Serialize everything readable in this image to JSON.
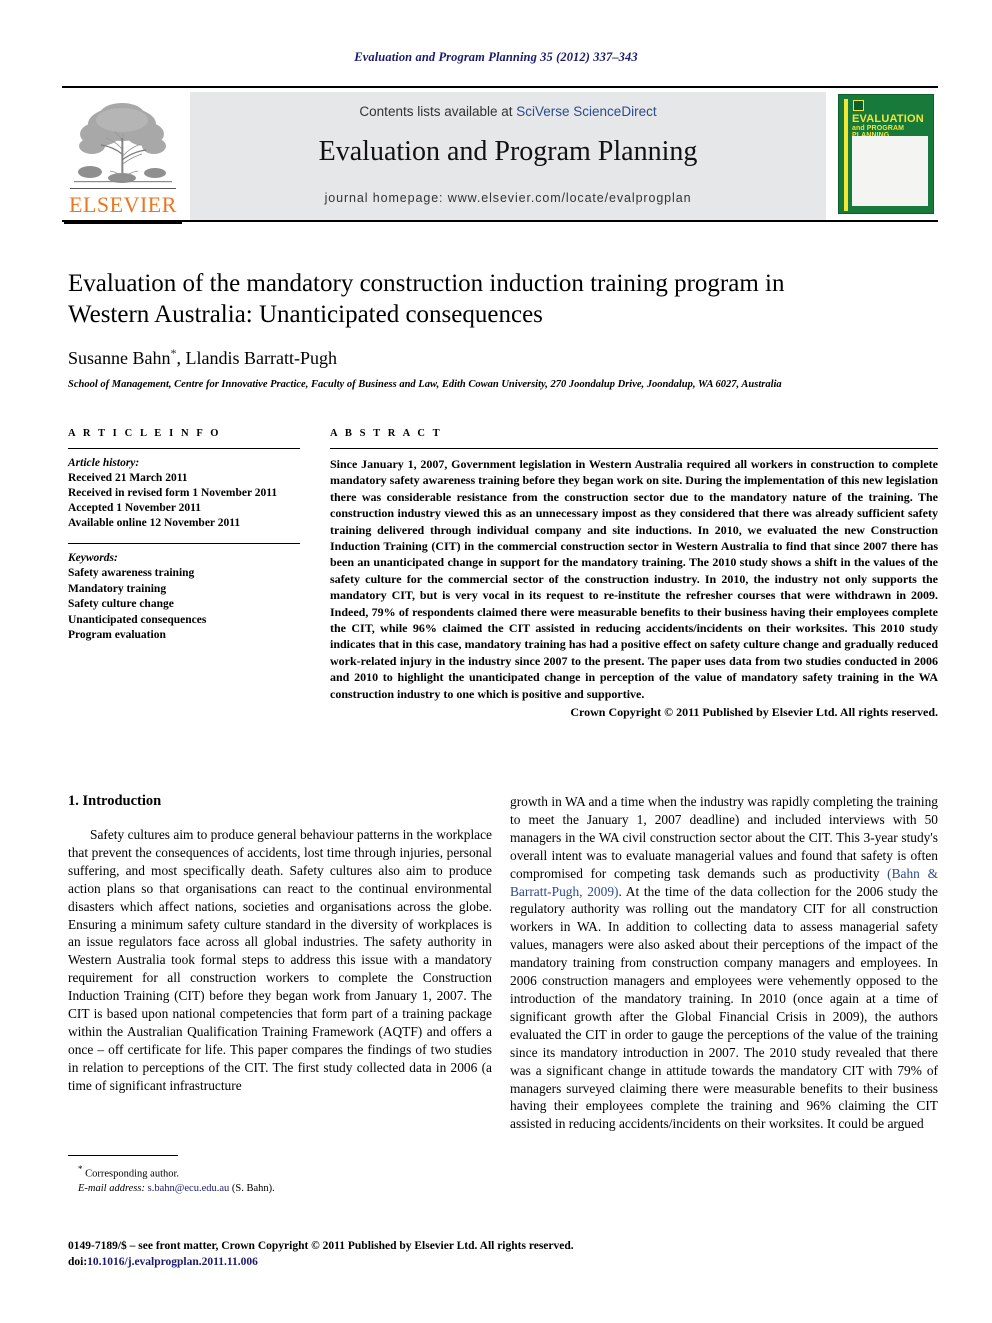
{
  "running_head": "Evaluation and Program Planning 35 (2012) 337–343",
  "masthead": {
    "contents_prefix": "Contents lists available at ",
    "contents_link": "SciVerse ScienceDirect",
    "journal_title": "Evaluation and Program Planning",
    "homepage": "journal homepage: www.elsevier.com/locate/evalprogplan",
    "publisher_name": "ELSEVIER",
    "cover": {
      "title_line1": "EVALUATION",
      "title_line2": "and PROGRAM PLANNING"
    }
  },
  "article": {
    "title": "Evaluation of the mandatory construction induction training program in Western Australia: Unanticipated consequences",
    "authors": "Susanne Bahn",
    "authors_rest": ", Llandis Barratt-Pugh",
    "corresponding_marker": "*",
    "affiliation": "School of Management, Centre for Innovative Practice, Faculty of Business and Law, Edith Cowan University, 270 Joondalup Drive, Joondalup, WA 6027, Australia"
  },
  "article_info": {
    "heading": "A R T I C L E   I N F O",
    "history_label": "Article history:",
    "history": [
      "Received 21 March 2011",
      "Received in revised form 1 November 2011",
      "Accepted 1 November 2011",
      "Available online 12 November 2011"
    ],
    "keywords_label": "Keywords:",
    "keywords": [
      "Safety awareness training",
      "Mandatory training",
      "Safety culture change",
      "Unanticipated consequences",
      "Program evaluation"
    ]
  },
  "abstract": {
    "heading": "A B S T R A C T",
    "text": "Since January 1, 2007, Government legislation in Western Australia required all workers in construction to complete mandatory safety awareness training before they began work on site. During the implementation of this new legislation there was considerable resistance from the construction sector due to the mandatory nature of the training. The construction industry viewed this as an unnecessary impost as they considered that there was already sufficient safety training delivered through individual company and site inductions. In 2010, we evaluated the new Construction Induction Training (CIT) in the commercial construction sector in Western Australia to find that since 2007 there has been an unanticipated change in support for the mandatory training. The 2010 study shows a shift in the values of the safety culture for the commercial sector of the construction industry. In 2010, the industry not only supports the mandatory CIT, but is very vocal in its request to re-institute the refresher courses that were withdrawn in 2009. Indeed, 79% of respondents claimed there were measurable benefits to their business having their employees complete the CIT, while 96% claimed the CIT assisted in reducing accidents/incidents on their worksites. This 2010 study indicates that in this case, mandatory training has had a positive effect on safety culture change and gradually reduced work-related injury in the industry since 2007 to the present. The paper uses data from two studies conducted in 2006 and 2010 to highlight the unanticipated change in perception of the value of mandatory safety training in the WA construction industry to one which is positive and supportive.",
    "copyright": "Crown Copyright © 2011 Published by Elsevier Ltd. All rights reserved."
  },
  "introduction": {
    "heading": "1. Introduction",
    "left_para_1": "Safety cultures aim to produce general behaviour patterns in the workplace that prevent the consequences of accidents, lost time through injuries, personal suffering, and most specifically death. Safety cultures also aim to produce action plans so that organisations can react to the continual environmental disasters which affect nations, societies and organisations across the globe. Ensuring a minimum safety culture standard in the diversity of workplaces is an issue regulators face across all global industries. The safety authority in Western Australia took formal steps to address this issue with a mandatory requirement for all construction workers to complete the Construction Induction Training (CIT) before they began work from January 1, 2007. The CIT is based upon national competencies that form part of a training package within the Australian Qualification Training Framework (AQTF) and offers a once – off certificate for life. This paper compares the findings of two studies in relation to perceptions of the CIT. The first study collected data in 2006 (a time of significant infrastructure",
    "right_part_1": "growth in WA and a time when the industry was rapidly completing the training to meet the January 1, 2007 deadline) and included interviews with 50 managers in the WA civil construction sector about the CIT. This 3-year study's overall intent was to evaluate managerial values and found that safety is often compromised for competing task demands such as productivity ",
    "right_citation": "(Bahn & Barratt-Pugh, 2009)",
    "right_part_2": ". At the time of the data collection for the 2006 study the regulatory authority was rolling out the mandatory CIT for all construction workers in WA. In addition to collecting data to assess managerial safety values, managers were also asked about their perceptions of the impact of the mandatory training from construction company managers and employees. In 2006 construction managers and employees were vehemently opposed to the introduction of the mandatory training. In 2010 (once again at a time of significant growth after the Global Financial Crisis in 2009), the authors evaluated the CIT in order to gauge the perceptions of the value of the training since its mandatory introduction in 2007. The 2010 study revealed that there was a significant change in attitude towards the mandatory CIT with 79% of managers surveyed claiming there were measurable benefits to their business having their employees complete the training and 96% claiming the CIT assisted in reducing accidents/incidents on their worksites. It could be argued"
  },
  "footnote": {
    "marker": "*",
    "corresponding": " Corresponding author.",
    "email_label": "E-mail address:",
    "email": "s.bahn@ecu.edu.au",
    "email_suffix": " (S. Bahn)."
  },
  "footer": {
    "line1": "0149-7189/$ – see front matter, Crown Copyright © 2011 Published by Elsevier Ltd. All rights reserved.",
    "doi_label": "doi:",
    "doi": "10.1016/j.evalprogplan.2011.11.006"
  }
}
